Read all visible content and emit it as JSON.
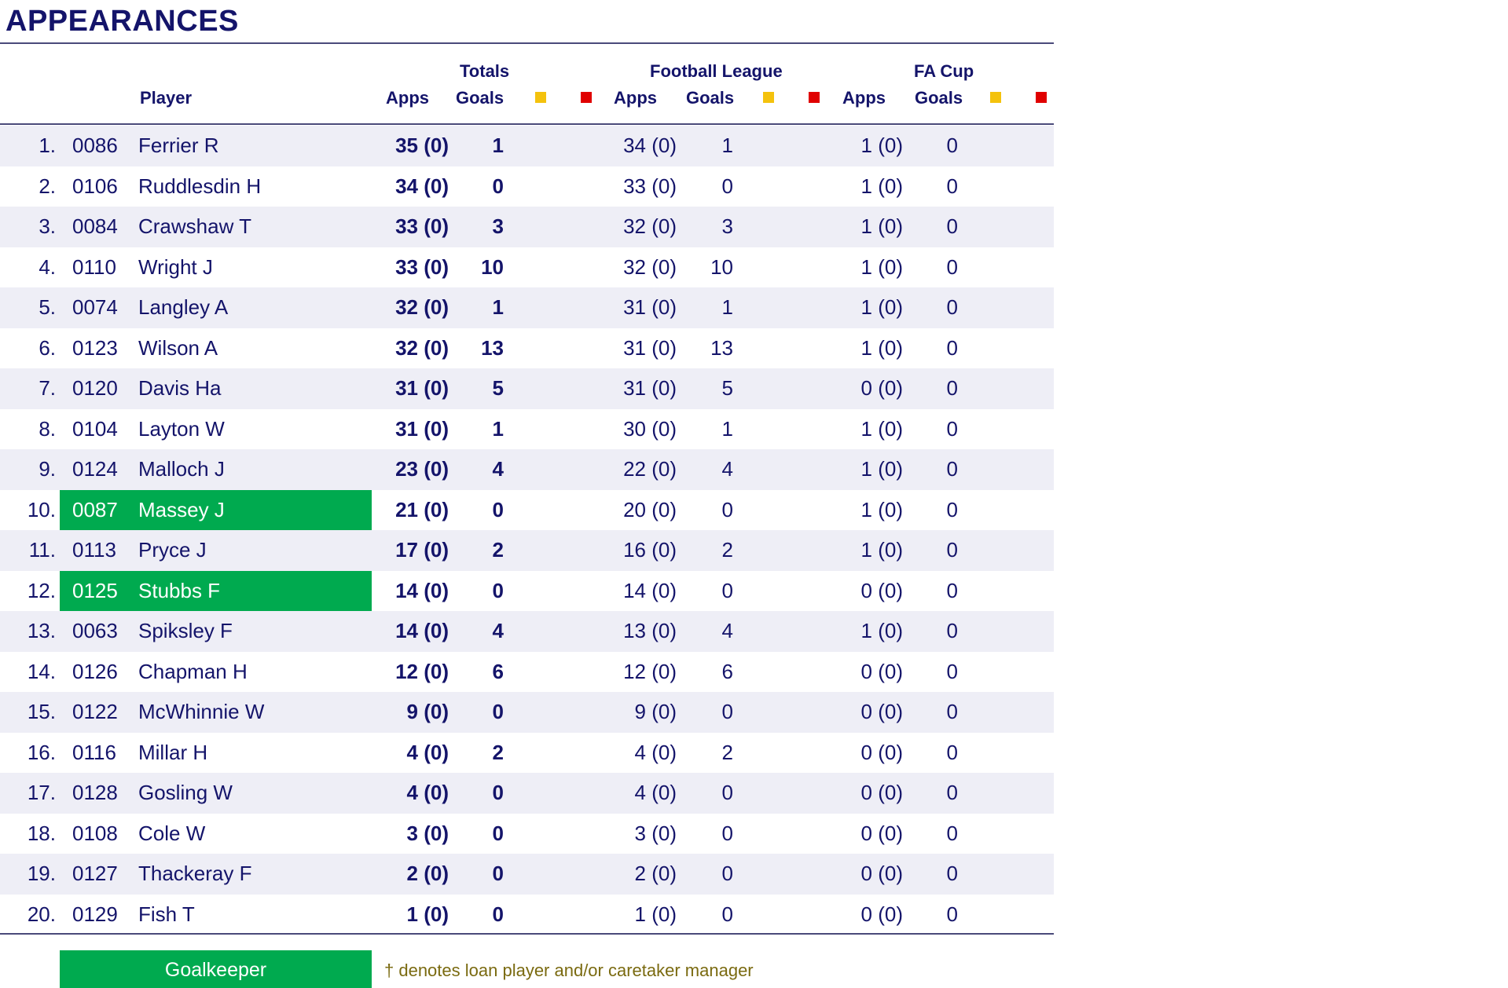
{
  "title": "APPEARANCES",
  "headers": {
    "player": "Player",
    "totals": "Totals",
    "football_league": "Football League",
    "fa_cup": "FA Cup",
    "apps": "Apps",
    "goals": "Goals"
  },
  "card_colors": {
    "yellow": "#f4c20d",
    "red": "#e00000"
  },
  "goalkeeper_color": "#00aa4f",
  "players": [
    {
      "rank": "1.",
      "code": "0086",
      "name": "Ferrier R",
      "total_apps": "35 (0)",
      "total_goals": "1",
      "league_apps": "34 (0)",
      "league_goals": "1",
      "cup_apps": "1 (0)",
      "cup_goals": "0",
      "goalkeeper": false
    },
    {
      "rank": "2.",
      "code": "0106",
      "name": "Ruddlesdin H",
      "total_apps": "34 (0)",
      "total_goals": "0",
      "league_apps": "33 (0)",
      "league_goals": "0",
      "cup_apps": "1 (0)",
      "cup_goals": "0",
      "goalkeeper": false
    },
    {
      "rank": "3.",
      "code": "0084",
      "name": "Crawshaw T",
      "total_apps": "33 (0)",
      "total_goals": "3",
      "league_apps": "32 (0)",
      "league_goals": "3",
      "cup_apps": "1 (0)",
      "cup_goals": "0",
      "goalkeeper": false
    },
    {
      "rank": "4.",
      "code": "0110",
      "name": "Wright J",
      "total_apps": "33 (0)",
      "total_goals": "10",
      "league_apps": "32 (0)",
      "league_goals": "10",
      "cup_apps": "1 (0)",
      "cup_goals": "0",
      "goalkeeper": false
    },
    {
      "rank": "5.",
      "code": "0074",
      "name": "Langley A",
      "total_apps": "32 (0)",
      "total_goals": "1",
      "league_apps": "31 (0)",
      "league_goals": "1",
      "cup_apps": "1 (0)",
      "cup_goals": "0",
      "goalkeeper": false
    },
    {
      "rank": "6.",
      "code": "0123",
      "name": "Wilson A",
      "total_apps": "32 (0)",
      "total_goals": "13",
      "league_apps": "31 (0)",
      "league_goals": "13",
      "cup_apps": "1 (0)",
      "cup_goals": "0",
      "goalkeeper": false
    },
    {
      "rank": "7.",
      "code": "0120",
      "name": "Davis Ha",
      "total_apps": "31 (0)",
      "total_goals": "5",
      "league_apps": "31 (0)",
      "league_goals": "5",
      "cup_apps": "0 (0)",
      "cup_goals": "0",
      "goalkeeper": false
    },
    {
      "rank": "8.",
      "code": "0104",
      "name": "Layton W",
      "total_apps": "31 (0)",
      "total_goals": "1",
      "league_apps": "30 (0)",
      "league_goals": "1",
      "cup_apps": "1 (0)",
      "cup_goals": "0",
      "goalkeeper": false
    },
    {
      "rank": "9.",
      "code": "0124",
      "name": "Malloch J",
      "total_apps": "23 (0)",
      "total_goals": "4",
      "league_apps": "22 (0)",
      "league_goals": "4",
      "cup_apps": "1 (0)",
      "cup_goals": "0",
      "goalkeeper": false
    },
    {
      "rank": "10.",
      "code": "0087",
      "name": "Massey J",
      "total_apps": "21 (0)",
      "total_goals": "0",
      "league_apps": "20 (0)",
      "league_goals": "0",
      "cup_apps": "1 (0)",
      "cup_goals": "0",
      "goalkeeper": true
    },
    {
      "rank": "11.",
      "code": "0113",
      "name": "Pryce J",
      "total_apps": "17 (0)",
      "total_goals": "2",
      "league_apps": "16 (0)",
      "league_goals": "2",
      "cup_apps": "1 (0)",
      "cup_goals": "0",
      "goalkeeper": false
    },
    {
      "rank": "12.",
      "code": "0125",
      "name": "Stubbs F",
      "total_apps": "14 (0)",
      "total_goals": "0",
      "league_apps": "14 (0)",
      "league_goals": "0",
      "cup_apps": "0 (0)",
      "cup_goals": "0",
      "goalkeeper": true
    },
    {
      "rank": "13.",
      "code": "0063",
      "name": "Spiksley F",
      "total_apps": "14 (0)",
      "total_goals": "4",
      "league_apps": "13 (0)",
      "league_goals": "4",
      "cup_apps": "1 (0)",
      "cup_goals": "0",
      "goalkeeper": false
    },
    {
      "rank": "14.",
      "code": "0126",
      "name": "Chapman H",
      "total_apps": "12 (0)",
      "total_goals": "6",
      "league_apps": "12 (0)",
      "league_goals": "6",
      "cup_apps": "0 (0)",
      "cup_goals": "0",
      "goalkeeper": false
    },
    {
      "rank": "15.",
      "code": "0122",
      "name": "McWhinnie W",
      "total_apps": "9 (0)",
      "total_goals": "0",
      "league_apps": "9 (0)",
      "league_goals": "0",
      "cup_apps": "0 (0)",
      "cup_goals": "0",
      "goalkeeper": false
    },
    {
      "rank": "16.",
      "code": "0116",
      "name": "Millar H",
      "total_apps": "4 (0)",
      "total_goals": "2",
      "league_apps": "4 (0)",
      "league_goals": "2",
      "cup_apps": "0 (0)",
      "cup_goals": "0",
      "goalkeeper": false
    },
    {
      "rank": "17.",
      "code": "0128",
      "name": "Gosling W",
      "total_apps": "4 (0)",
      "total_goals": "0",
      "league_apps": "4 (0)",
      "league_goals": "0",
      "cup_apps": "0 (0)",
      "cup_goals": "0",
      "goalkeeper": false
    },
    {
      "rank": "18.",
      "code": "0108",
      "name": "Cole W",
      "total_apps": "3 (0)",
      "total_goals": "0",
      "league_apps": "3 (0)",
      "league_goals": "0",
      "cup_apps": "0 (0)",
      "cup_goals": "0",
      "goalkeeper": false
    },
    {
      "rank": "19.",
      "code": "0127",
      "name": "Thackeray F",
      "total_apps": "2 (0)",
      "total_goals": "0",
      "league_apps": "2 (0)",
      "league_goals": "0",
      "cup_apps": "0 (0)",
      "cup_goals": "0",
      "goalkeeper": false
    },
    {
      "rank": "20.",
      "code": "0129",
      "name": "Fish T",
      "total_apps": "1 (0)",
      "total_goals": "0",
      "league_apps": "1 (0)",
      "league_goals": "0",
      "cup_apps": "0 (0)",
      "cup_goals": "0",
      "goalkeeper": false
    }
  ],
  "legend": {
    "goalkeeper_label": "Goalkeeper",
    "note": "† denotes loan player and/or caretaker manager"
  }
}
